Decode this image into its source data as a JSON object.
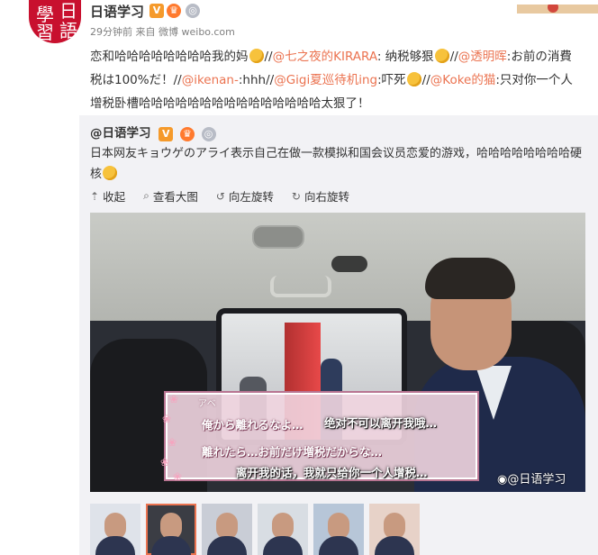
{
  "post": {
    "author": "日语学习",
    "avatar_text": [
      "日",
      "語",
      "學",
      "習"
    ],
    "time": "29分钟前",
    "source_prefix": "来自",
    "source": "微博 weibo.com",
    "text_parts": [
      {
        "t": "恋和哈哈哈哈哈哈哈哈我的妈",
        "type": "text"
      },
      {
        "t": "",
        "type": "emoji"
      },
      {
        "t": "//",
        "type": "text"
      },
      {
        "t": "@七之夜的KIRARA",
        "type": "link"
      },
      {
        "t": ": 纳税够狠",
        "type": "text"
      },
      {
        "t": "",
        "type": "emoji"
      },
      {
        "t": "//",
        "type": "text"
      },
      {
        "t": "@透明晖",
        "type": "link"
      },
      {
        "t": ":お前の消費税は100%だ！//",
        "type": "text"
      },
      {
        "t": "@ikenan-",
        "type": "link"
      },
      {
        "t": ":hhh//",
        "type": "text"
      },
      {
        "t": "@Gigi夏巡待机ing",
        "type": "link"
      },
      {
        "t": ":吓死",
        "type": "text"
      },
      {
        "t": "",
        "type": "emoji"
      },
      {
        "t": "//",
        "type": "text"
      },
      {
        "t": "@Koke的猫",
        "type": "link"
      },
      {
        "t": ":只对你一个人增税卧槽哈哈哈哈哈哈哈哈哈哈哈哈哈哈哈太狠了！",
        "type": "text"
      }
    ]
  },
  "repost": {
    "author": "@日语学习",
    "text": "日本网友キョウゲのアライ表示自己在做一款模拟和国会议员恋爱的游戏，哈哈哈哈哈哈哈哈硬核",
    "tools": [
      {
        "icon": "collapse-icon",
        "glyph": "⇡",
        "label": "收起"
      },
      {
        "icon": "search-icon",
        "glyph": "⌕",
        "label": "查看大图"
      },
      {
        "icon": "rotate-left-icon",
        "glyph": "↺",
        "label": "向左旋转"
      },
      {
        "icon": "rotate-right-icon",
        "glyph": "↻",
        "label": "向右旋转"
      }
    ],
    "image": {
      "sub_small": "アベ",
      "jp1": "俺から離れるなよ…",
      "cn1": "绝对不可以离开我哦…",
      "jp2": "離れたら…お前だけ増税だからな…",
      "cn2": "离开我的话，我就只给你一个人增税…",
      "watermark": "@日语学习"
    },
    "thumb_count": 6,
    "selected_thumb": 1
  },
  "colors": {
    "link": "#eb7350",
    "accent": "#c8102e"
  }
}
